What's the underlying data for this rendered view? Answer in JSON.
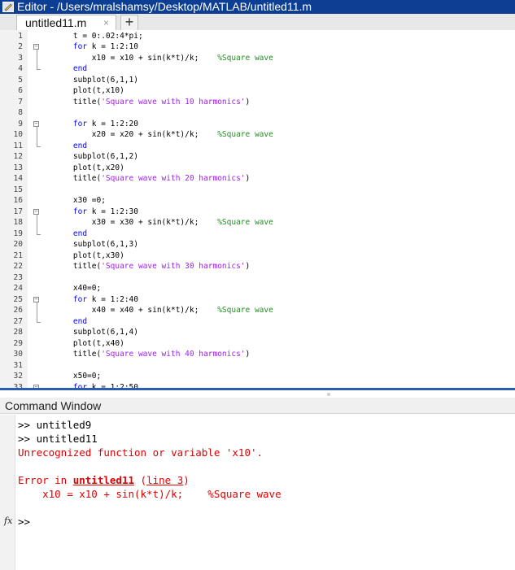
{
  "window": {
    "title": "Editor - /Users/mralshamsy/Desktop/MATLAB/untitled11.m"
  },
  "tabs": [
    {
      "label": "untitled11.m",
      "close": "×"
    }
  ],
  "add_tab_label": "+",
  "editor": {
    "lines": [
      {
        "n": "1",
        "segs": [
          {
            "t": "    t = 0:.02:4*pi;",
            "c": ""
          }
        ]
      },
      {
        "n": "2",
        "segs": [
          {
            "t": "    ",
            "c": ""
          },
          {
            "t": "for",
            "c": "kw"
          },
          {
            "t": " k = 1:2:10",
            "c": ""
          }
        ]
      },
      {
        "n": "3",
        "segs": [
          {
            "t": "        x10 = x10 + sin(k*t)/k;    ",
            "c": ""
          },
          {
            "t": "%Square wave",
            "c": "cm"
          }
        ]
      },
      {
        "n": "4",
        "segs": [
          {
            "t": "    ",
            "c": ""
          },
          {
            "t": "end",
            "c": "kw"
          }
        ]
      },
      {
        "n": "5",
        "segs": [
          {
            "t": "    subplot(6,1,1)",
            "c": ""
          }
        ]
      },
      {
        "n": "6",
        "segs": [
          {
            "t": "    plot(t,x10)",
            "c": ""
          }
        ]
      },
      {
        "n": "7",
        "segs": [
          {
            "t": "    title(",
            "c": ""
          },
          {
            "t": "'Square wave with 10 harmonics'",
            "c": "str"
          },
          {
            "t": ")",
            "c": ""
          }
        ]
      },
      {
        "n": "8",
        "segs": []
      },
      {
        "n": "9",
        "segs": [
          {
            "t": "    ",
            "c": ""
          },
          {
            "t": "for",
            "c": "kw"
          },
          {
            "t": " k = 1:2:20",
            "c": ""
          }
        ]
      },
      {
        "n": "10",
        "segs": [
          {
            "t": "        x20 = x20 + sin(k*t)/k;    ",
            "c": ""
          },
          {
            "t": "%Square wave",
            "c": "cm"
          }
        ]
      },
      {
        "n": "11",
        "segs": [
          {
            "t": "    ",
            "c": ""
          },
          {
            "t": "end",
            "c": "kw"
          }
        ]
      },
      {
        "n": "12",
        "segs": [
          {
            "t": "    subplot(6,1,2)",
            "c": ""
          }
        ]
      },
      {
        "n": "13",
        "segs": [
          {
            "t": "    plot(t,x20)",
            "c": ""
          }
        ]
      },
      {
        "n": "14",
        "segs": [
          {
            "t": "    title(",
            "c": ""
          },
          {
            "t": "'Square wave with 20 harmonics'",
            "c": "str"
          },
          {
            "t": ")",
            "c": ""
          }
        ]
      },
      {
        "n": "15",
        "segs": []
      },
      {
        "n": "16",
        "segs": [
          {
            "t": "    x30 =0;",
            "c": ""
          }
        ]
      },
      {
        "n": "17",
        "segs": [
          {
            "t": "    ",
            "c": ""
          },
          {
            "t": "for",
            "c": "kw"
          },
          {
            "t": " k = 1:2:30",
            "c": ""
          }
        ]
      },
      {
        "n": "18",
        "segs": [
          {
            "t": "        x30 = x30 + sin(k*t)/k;    ",
            "c": ""
          },
          {
            "t": "%Square wave",
            "c": "cm"
          }
        ]
      },
      {
        "n": "19",
        "segs": [
          {
            "t": "    ",
            "c": ""
          },
          {
            "t": "end",
            "c": "kw"
          }
        ]
      },
      {
        "n": "20",
        "segs": [
          {
            "t": "    subplot(6,1,3)",
            "c": ""
          }
        ]
      },
      {
        "n": "21",
        "segs": [
          {
            "t": "    plot(t,x30)",
            "c": ""
          }
        ]
      },
      {
        "n": "22",
        "segs": [
          {
            "t": "    title(",
            "c": ""
          },
          {
            "t": "'Square wave with 30 harmonics'",
            "c": "str"
          },
          {
            "t": ")",
            "c": ""
          }
        ]
      },
      {
        "n": "23",
        "segs": []
      },
      {
        "n": "24",
        "segs": [
          {
            "t": "    x40=0;",
            "c": ""
          }
        ]
      },
      {
        "n": "25",
        "segs": [
          {
            "t": "    ",
            "c": ""
          },
          {
            "t": "for",
            "c": "kw"
          },
          {
            "t": " k = 1:2:40",
            "c": ""
          }
        ]
      },
      {
        "n": "26",
        "segs": [
          {
            "t": "        x40 = x40 + sin(k*t)/k;    ",
            "c": ""
          },
          {
            "t": "%Square wave",
            "c": "cm"
          }
        ]
      },
      {
        "n": "27",
        "segs": [
          {
            "t": "    ",
            "c": ""
          },
          {
            "t": "end",
            "c": "kw"
          }
        ]
      },
      {
        "n": "28",
        "segs": [
          {
            "t": "    subplot(6,1,4)",
            "c": ""
          }
        ]
      },
      {
        "n": "29",
        "segs": [
          {
            "t": "    plot(t,x40)",
            "c": ""
          }
        ]
      },
      {
        "n": "30",
        "segs": [
          {
            "t": "    title(",
            "c": ""
          },
          {
            "t": "'Square wave with 40 harmonics'",
            "c": "str"
          },
          {
            "t": ")",
            "c": ""
          }
        ]
      },
      {
        "n": "31",
        "segs": []
      },
      {
        "n": "32",
        "segs": [
          {
            "t": "    x50=0;",
            "c": ""
          }
        ]
      },
      {
        "n": "33",
        "segs": [
          {
            "t": "    ",
            "c": ""
          },
          {
            "t": "for",
            "c": "kw"
          },
          {
            "t": " k = 1:2:50",
            "c": ""
          }
        ]
      }
    ],
    "fold_markers": [
      "2",
      "9",
      "17",
      "25",
      "33"
    ]
  },
  "command_window": {
    "title": "Command Window",
    "prompt_1": ">> untitled9",
    "prompt_2": ">> untitled11",
    "error_message": "Unrecognized function or variable 'x10'.",
    "error_in_prefix": "Error in ",
    "error_in_file": "untitled11",
    "error_in_sep": " (",
    "error_in_line": "line 3",
    "error_in_suffix": ")",
    "error_code": "    x10 = x10 + sin(k*t)/k;    %Square wave",
    "fx_label": "fx",
    "prompt_current": ">>"
  },
  "colors": {
    "title_bar": "#0c3f93",
    "keyword": "#0000ff",
    "string": "#a020f0",
    "comment": "#228b22",
    "error": "#e00000"
  }
}
